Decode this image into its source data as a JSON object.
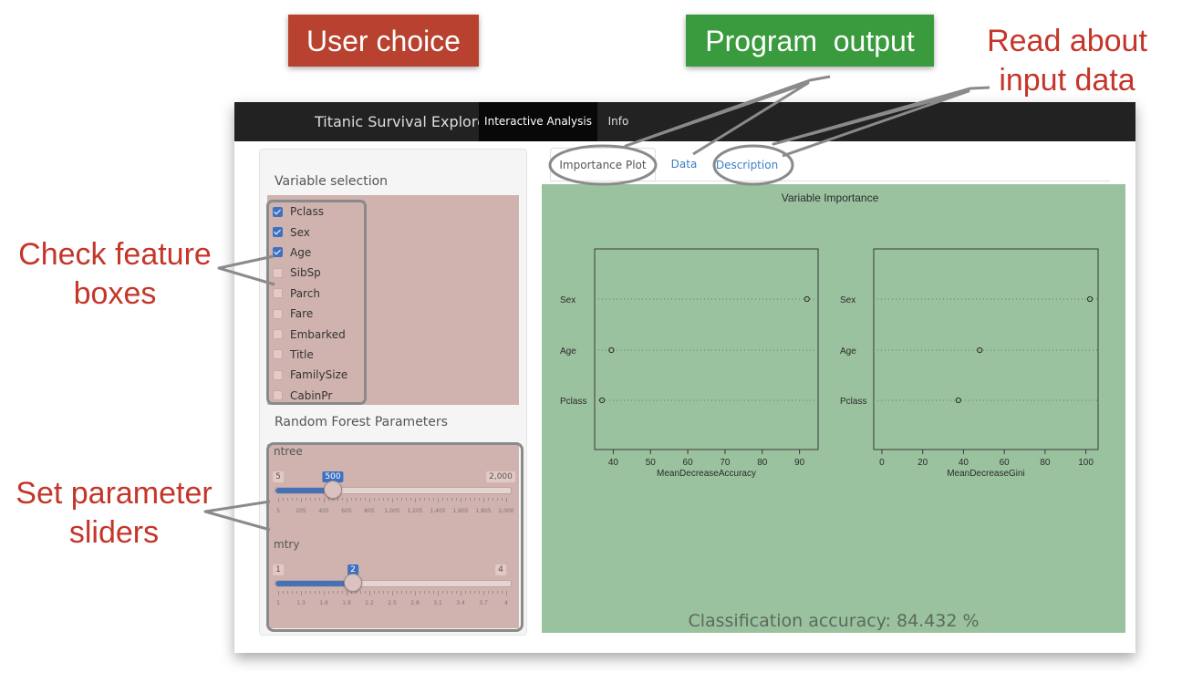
{
  "callouts": {
    "user_choice": "User choice",
    "program_output": "Program  output",
    "read_about_line1": "Read about",
    "read_about_line2": "input data",
    "check_feature_line1": "Check feature",
    "check_feature_line2": "boxes",
    "set_params_line1": "Set parameter",
    "set_params_line2": "sliders"
  },
  "colors": {
    "user_choice_bg": "#b8412f",
    "program_output_bg": "#3a9a3e",
    "annotation_text": "#c4362a",
    "selection_highlight": "#d0b3af",
    "output_highlight": "#9bc29f",
    "navbar_bg": "#222222",
    "accent_blue": "#3e72c1"
  },
  "navbar": {
    "brand": "Titanic Survival Explorer",
    "tabs": [
      {
        "label": "Interactive Analysis",
        "active": true
      },
      {
        "label": "Info",
        "active": false
      }
    ]
  },
  "sidebar": {
    "variable_title": "Variable selection",
    "variables": [
      {
        "label": "Pclass",
        "checked": true
      },
      {
        "label": "Sex",
        "checked": true
      },
      {
        "label": "Age",
        "checked": true
      },
      {
        "label": "SibSp",
        "checked": false
      },
      {
        "label": "Parch",
        "checked": false
      },
      {
        "label": "Fare",
        "checked": false
      },
      {
        "label": "Embarked",
        "checked": false
      },
      {
        "label": "Title",
        "checked": false
      },
      {
        "label": "FamilySize",
        "checked": false
      },
      {
        "label": "CabinPr",
        "checked": false
      }
    ],
    "rf_title": "Random Forest Parameters",
    "sliders": [
      {
        "label": "ntree",
        "min": 5,
        "max": 2000,
        "value": 500,
        "min_label": "5",
        "max_label": "2,000",
        "value_label": "500",
        "ticks": [
          "5",
          "205",
          "405",
          "605",
          "805",
          "1,005",
          "1,205",
          "1,405",
          "1,605",
          "1,805",
          "2,000"
        ]
      },
      {
        "label": "mtry",
        "min": 1,
        "max": 4,
        "value": 2,
        "min_label": "1",
        "max_label": "4",
        "value_label": "2",
        "ticks": [
          "1",
          "1.3",
          "1.6",
          "1.9",
          "2.2",
          "2.5",
          "2.8",
          "3.1",
          "3.4",
          "3.7",
          "4"
        ]
      }
    ]
  },
  "main_tabs": [
    {
      "label": "Importance Plot",
      "active": true
    },
    {
      "label": "Data",
      "active": false
    },
    {
      "label": "Description",
      "active": false
    }
  ],
  "chart_data": [
    {
      "type": "scatter",
      "title": "Variable Importance",
      "xlabel": "MeanDecreaseAccuracy",
      "categories": [
        "Sex",
        "Age",
        "Pclass"
      ],
      "values": [
        92,
        39.5,
        37
      ],
      "xlim": [
        35,
        95
      ],
      "xticks": [
        40,
        50,
        60,
        70,
        80,
        90
      ],
      "grid": "dotted horizontal"
    },
    {
      "type": "scatter",
      "xlabel": "MeanDecreaseGini",
      "categories": [
        "Sex",
        "Age",
        "Pclass"
      ],
      "values": [
        102,
        48,
        37.5
      ],
      "xlim": [
        -4,
        106
      ],
      "xticks": [
        0,
        20,
        40,
        60,
        80,
        100
      ],
      "grid": "dotted horizontal"
    }
  ],
  "output": {
    "accuracy_text": "Classification accuracy: 84.432 %"
  }
}
